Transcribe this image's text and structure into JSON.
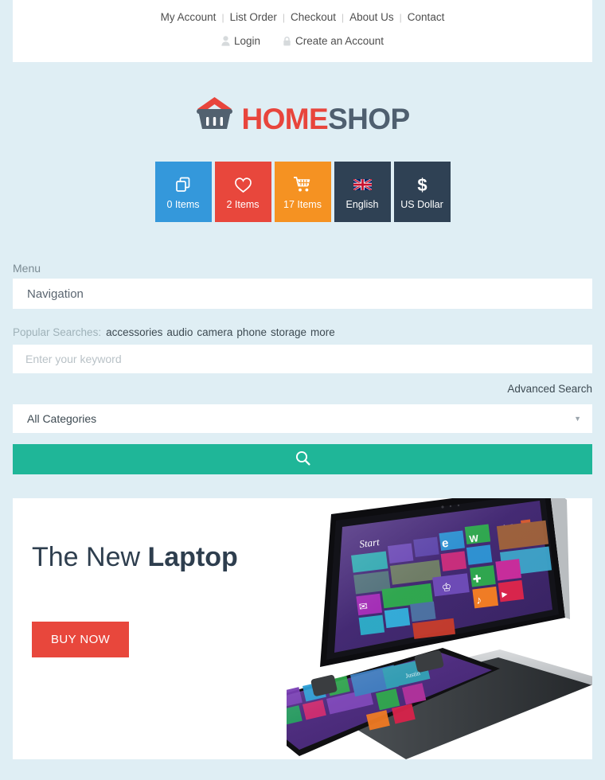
{
  "topbar": {
    "links": [
      {
        "label": "My Account"
      },
      {
        "label": "List Order"
      },
      {
        "label": "Checkout"
      },
      {
        "label": "About Us"
      },
      {
        "label": "Contact"
      }
    ],
    "separator": "|",
    "account": [
      {
        "label": "Login",
        "icon": "user-icon"
      },
      {
        "label": "Create an Account",
        "icon": "lock-icon"
      }
    ]
  },
  "logo": {
    "part1": "HOME",
    "part2": "SHOP",
    "icon": "basket-house-icon",
    "color1": "#e8453c",
    "color2": "#4f5f6f"
  },
  "tiles": [
    {
      "label": "0 Items",
      "icon": "compare-icon",
      "color": "#3498db"
    },
    {
      "label": "2 Items",
      "icon": "heart-icon",
      "color": "#e8473c"
    },
    {
      "label": "17 Items",
      "icon": "cart-icon",
      "color": "#f59222"
    },
    {
      "label": "English",
      "icon": "uk-flag-icon",
      "color": "#2f4154"
    },
    {
      "label": "US Dollar",
      "icon": "dollar-icon",
      "color": "#2f4154"
    }
  ],
  "menu": {
    "label": "Menu",
    "navigation_label": "Navigation"
  },
  "popular": {
    "label": "Popular Searches:",
    "terms": [
      "accessories",
      "audio",
      "camera",
      "phone",
      "storage",
      "more"
    ]
  },
  "search": {
    "placeholder": "Enter your keyword",
    "value": "",
    "advanced_label": "Advanced Search",
    "category_selected": "All Categories",
    "category_options": [
      "All Categories"
    ],
    "caret": "▼",
    "button_icon": "search-icon",
    "button_color": "#1fb698"
  },
  "banner": {
    "title_regular": "The New ",
    "title_bold": "Laptop",
    "cta_label": "BUY NOW",
    "cta_color": "#e8473c",
    "artwork": "windows8-convertible-laptop-start-screen",
    "artwork_caption": "Start"
  }
}
